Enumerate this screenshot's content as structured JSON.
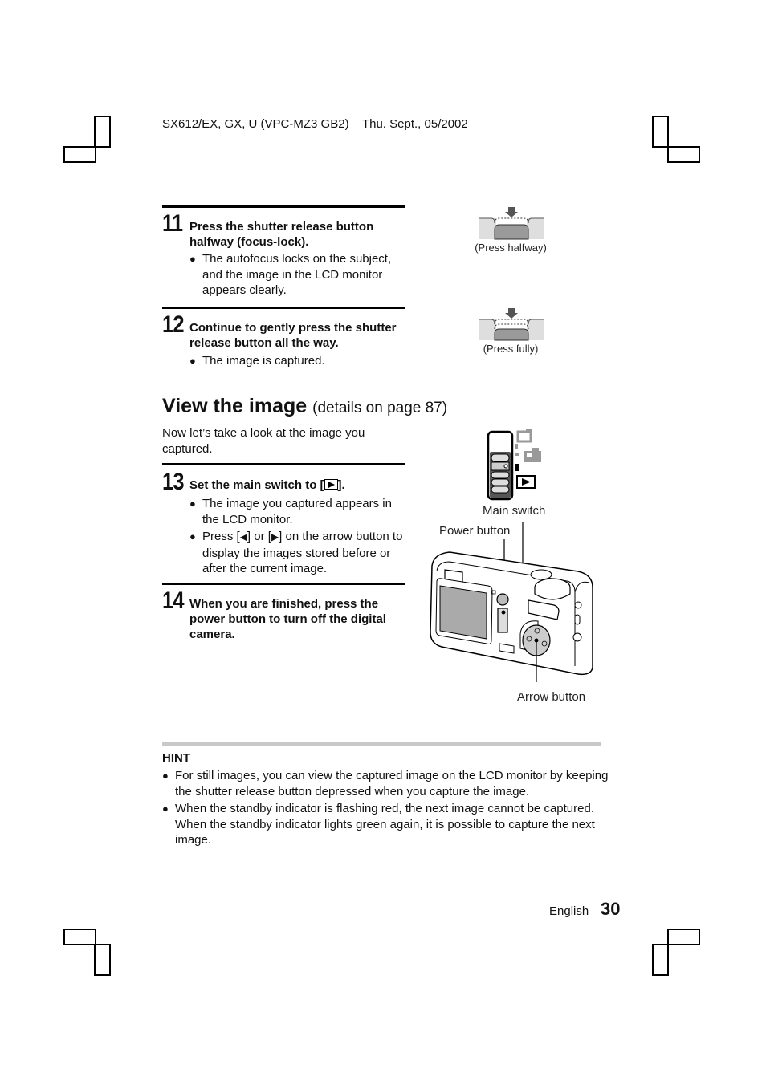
{
  "header": {
    "model_line": "SX612/EX, GX, U (VPC-MZ3 GB2)    Thu. Sept., 05/2002"
  },
  "steps": [
    {
      "number": "11",
      "title": "Press the shutter release button halfway (focus-lock).",
      "bullets": [
        "The autofocus locks on the subject, and the image in the LCD monitor appears clearly."
      ],
      "figure_caption": "(Press halfway)"
    },
    {
      "number": "12",
      "title": "Continue to gently press the shutter release button all the way.",
      "bullets": [
        "The image is captured."
      ],
      "figure_caption": "(Press fully)"
    },
    {
      "number": "13",
      "title_prefix": "Set the main switch to [",
      "title_icon": "play-icon",
      "title_suffix": "].",
      "bullets": [
        "The image you captured appears in the LCD monitor.",
        {
          "prefix": "Press [",
          "icon1": "◀",
          "mid": "] or [",
          "icon2": "▶",
          "suffix": "] on the arrow button to display the images stored before or after the current image."
        }
      ]
    },
    {
      "number": "14",
      "title": "When you are finished, press the power button to turn off the digital camera."
    }
  ],
  "section": {
    "title": "View the image",
    "subtitle": "(details on page 87)",
    "intro": "Now let’s take a look at the image you captured."
  },
  "camera_figure": {
    "main_switch_label": "Main switch",
    "power_button_label": "Power button",
    "arrow_button_label": "Arrow button"
  },
  "hint": {
    "title": "HINT",
    "items": [
      "For still images, you can view the captured image on the LCD monitor by keeping the shutter release button depressed when you capture the image.",
      "When the standby indicator is flashing red, the next image cannot be captured. When the standby indicator lights green again, it is possible to capture the next image."
    ]
  },
  "footer": {
    "language": "English",
    "page_number": "30"
  },
  "bullet_glyph": "●"
}
